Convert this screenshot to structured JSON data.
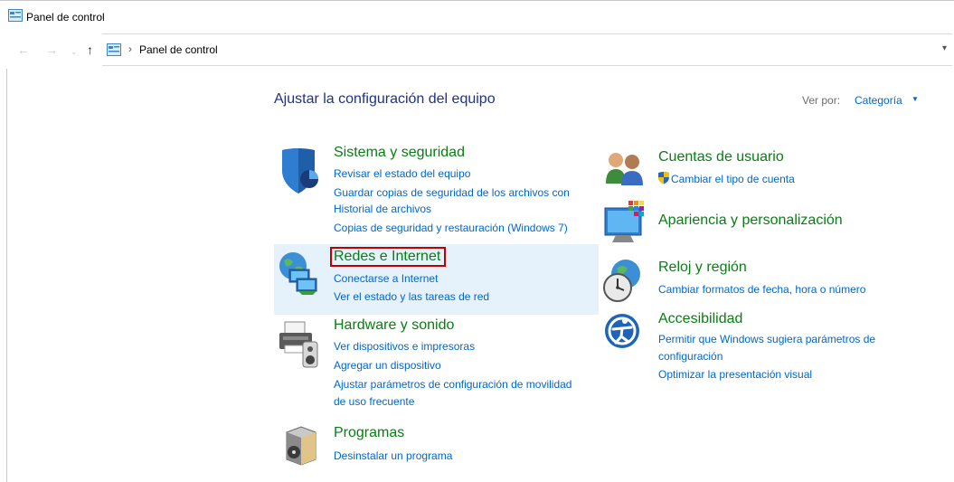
{
  "window": {
    "title": "Panel de control"
  },
  "address": {
    "path": "Panel de control"
  },
  "main": {
    "heading": "Ajustar la configuración del equipo",
    "view_by_label": "Ver por:",
    "view_by_value": "Categoría"
  },
  "categories": [
    {
      "title": "Sistema y seguridad",
      "icon": "shield-icon",
      "links": [
        "Revisar el estado del equipo",
        "Guardar copias de seguridad de los archivos con",
        "Historial de archivos",
        "Copias de seguridad y restauración (Windows 7)"
      ]
    },
    {
      "title": "Redes e Internet",
      "icon": "network-globe-icon",
      "links": [
        "Conectarse a Internet",
        "Ver el estado y las tareas de red"
      ]
    },
    {
      "title": "Hardware y sonido",
      "icon": "printer-speaker-icon",
      "links": [
        "Ver dispositivos e impresoras",
        "Agregar un dispositivo",
        "Ajustar parámetros de configuración de movilidad",
        "de uso frecuente"
      ]
    },
    {
      "title": "Programas",
      "icon": "programs-box-icon",
      "links": [
        "Desinstalar un programa"
      ]
    },
    {
      "title": "Cuentas de usuario",
      "icon": "users-icon",
      "links": [
        "Cambiar el tipo de cuenta"
      ]
    },
    {
      "title": "Apariencia y personalización",
      "icon": "monitor-palette-icon",
      "links": []
    },
    {
      "title": "Reloj y región",
      "icon": "clock-globe-icon",
      "links": [
        "Cambiar formatos de fecha, hora o número"
      ]
    },
    {
      "title": "Accesibilidad",
      "icon": "accessibility-icon",
      "links": [
        "Permitir que Windows sugiera parámetros de",
        "configuración",
        "Optimizar la presentación visual"
      ]
    }
  ],
  "colors": {
    "category_title": "#0a7d14",
    "link": "#0066cc",
    "heading": "#1e3287",
    "highlight": "#e5f1fb",
    "focus_outline": "#c00000"
  }
}
